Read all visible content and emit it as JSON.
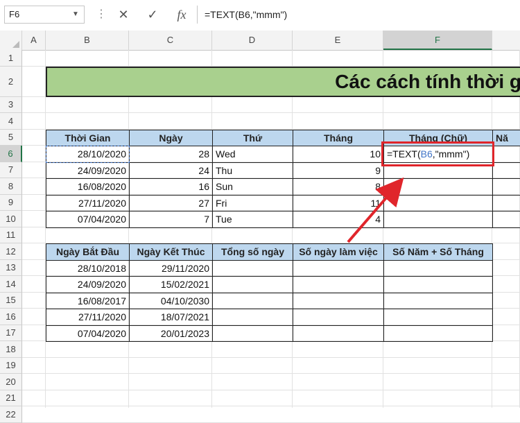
{
  "formula_bar": {
    "name_box": "F6",
    "formula": "=TEXT(B6,\"mmm\")",
    "cancel_label": "✕",
    "enter_label": "✓",
    "fx_label": "fx"
  },
  "columns": [
    "A",
    "B",
    "C",
    "D",
    "E",
    "F"
  ],
  "rows": [
    "1",
    "2",
    "3",
    "4",
    "5",
    "6",
    "7",
    "8",
    "9",
    "10",
    "11",
    "12",
    "13",
    "14",
    "15",
    "16",
    "17",
    "18",
    "19",
    "20",
    "21",
    "22"
  ],
  "title": "Các cách tính thời g",
  "table1": {
    "headers": [
      "Thời Gian",
      "Ngày",
      "Thứ",
      "Tháng",
      "Tháng (Chữ)",
      "Nă"
    ],
    "rows": [
      [
        "28/10/2020",
        "28",
        "Wed",
        "10"
      ],
      [
        "24/09/2020",
        "24",
        "Thu",
        "9"
      ],
      [
        "16/08/2020",
        "16",
        "Sun",
        "8"
      ],
      [
        "27/11/2020",
        "27",
        "Fri",
        "11"
      ],
      [
        "07/04/2020",
        "7",
        "Tue",
        "4"
      ]
    ],
    "editing_formula": {
      "prefix": "=TEXT(",
      "ref": "B6",
      "suffix": ",\"mmm\")"
    }
  },
  "table2": {
    "headers": [
      "Ngày Bắt Đầu",
      "Ngày Kết Thúc",
      "Tổng số ngày",
      "Số ngày làm việc",
      "Số Năm + Số Tháng"
    ],
    "rows": [
      [
        "28/10/2018",
        "29/11/2020"
      ],
      [
        "24/09/2020",
        "15/02/2021"
      ],
      [
        "16/08/2017",
        "04/10/2030"
      ],
      [
        "27/11/2020",
        "18/07/2021"
      ],
      [
        "07/04/2020",
        "20/01/2023"
      ]
    ]
  },
  "colors": {
    "title_fill": "#a9d08e",
    "header_fill": "#bdd7ee",
    "selection": "#217346",
    "annotation": "#e0252b",
    "cell_ref": "#3f73c6"
  }
}
